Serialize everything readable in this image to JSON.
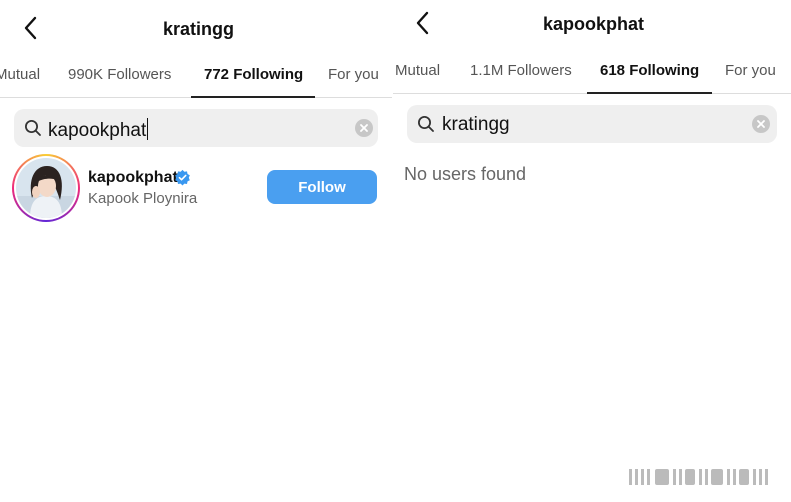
{
  "left": {
    "title": "kratingg",
    "tabs": [
      {
        "label": "Mutual",
        "active": false
      },
      {
        "label": "990K Followers",
        "active": false
      },
      {
        "label": "772 Following",
        "active": true
      },
      {
        "label": "For you",
        "active": false
      }
    ],
    "search": {
      "value": "kapookphat",
      "cursor_visible": true
    },
    "results": [
      {
        "username": "kapookphat",
        "verified": true,
        "full_name": "Kapook Ploynira",
        "button_label": "Follow"
      }
    ]
  },
  "right": {
    "title": "kapookphat",
    "tabs": [
      {
        "label": "Mutual",
        "active": false
      },
      {
        "label": "1.1M Followers",
        "active": false
      },
      {
        "label": "618 Following",
        "active": true
      },
      {
        "label": "For you",
        "active": false
      }
    ],
    "search": {
      "value": "kratingg"
    },
    "empty_message": "No users found"
  },
  "colors": {
    "accent_blue": "#4a9ff0",
    "verified_blue": "#3897f0",
    "search_bg": "#efefef",
    "muted_text": "#666666"
  },
  "icons": [
    "back-chevron-icon",
    "search-icon",
    "clear-icon",
    "verified-badge-icon"
  ]
}
